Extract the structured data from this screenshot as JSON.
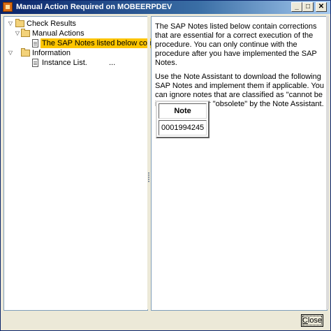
{
  "window": {
    "title": "Manual Action Required on MOBEERPDEV",
    "minimize_glyph": "_",
    "maximize_glyph": "□",
    "close_glyph": "✕"
  },
  "tree": {
    "root": {
      "label": "Check Results",
      "twisty": "▽"
    },
    "manual_actions": {
      "label": "Manual Actions",
      "twisty": "▽"
    },
    "selected_item": {
      "label": "The SAP Notes listed below conta..."
    },
    "information": {
      "label": "Information",
      "twisty": "▽"
    },
    "instance_list": {
      "label": "Instance List.",
      "suffix": "..."
    }
  },
  "details": {
    "paragraph1": "The SAP Notes listed below contain corrections that are essential for a correct execution of the procedure. You can only continue with the procedure after you have implemented the SAP Notes.",
    "paragraph2": "Use the Note Assistant to download the following SAP Notes and implement them if applicable. You can ignore notes that are classified as \"cannot be implemented\" or \"obsolete\" by the Note Assistant.",
    "table": {
      "header": "Note",
      "rows": [
        "0001994245"
      ]
    }
  },
  "footer": {
    "close_mnemonic": "C",
    "close_rest": "lose"
  },
  "colors": {
    "selection": "#fdc500",
    "titlebar": "#0a246a",
    "pane_border": "#7f9db9"
  }
}
